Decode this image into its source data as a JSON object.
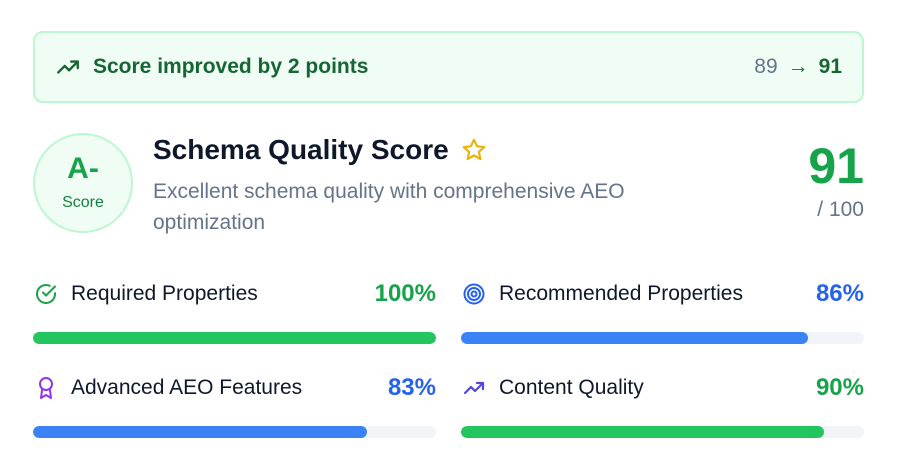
{
  "banner": {
    "message": "Score improved by 2 points",
    "from": "89",
    "arrow": "→",
    "to": "91",
    "icon": "trending-up-icon"
  },
  "grade": {
    "letter": "A-",
    "label": "Score"
  },
  "header": {
    "title": "Schema Quality Score",
    "star_icon": "star-icon",
    "description": "Excellent schema quality with comprehensive AEO optimization"
  },
  "total": {
    "score": "91",
    "max": "/ 100"
  },
  "metrics": [
    {
      "label": "Required Properties",
      "percent_text": "100%",
      "value": 100,
      "icon": "check-circle-icon",
      "color": "#16a34a",
      "bar_color": "#22c55e"
    },
    {
      "label": "Recommended Properties",
      "percent_text": "86%",
      "value": 86,
      "icon": "target-icon",
      "color": "#2563eb",
      "bar_color": "#3b82f6"
    },
    {
      "label": "Advanced AEO Features",
      "percent_text": "83%",
      "value": 83,
      "icon": "award-icon",
      "color": "#2563eb",
      "bar_color": "#3b82f6"
    },
    {
      "label": "Content Quality",
      "percent_text": "90%",
      "value": 90,
      "icon": "trending-up-icon",
      "color": "#16a34a",
      "bar_color": "#22c55e"
    }
  ]
}
